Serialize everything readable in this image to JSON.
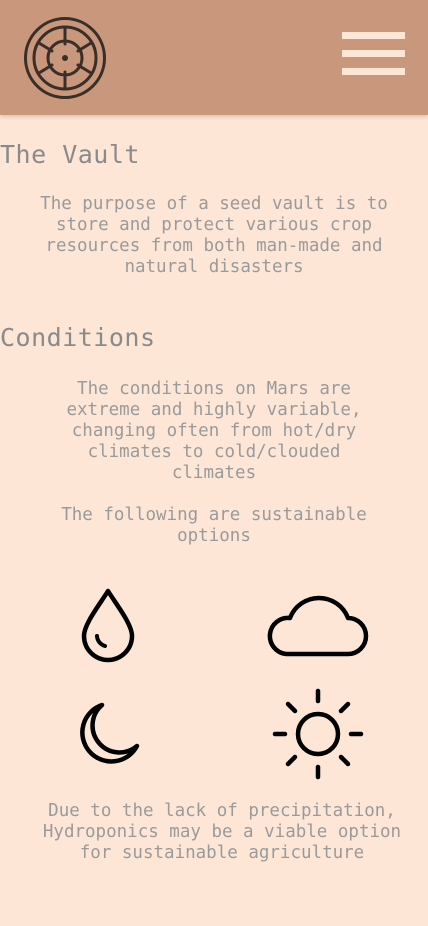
{
  "header": {
    "logo_icon": "vault-wheel-icon",
    "menu_icon": "hamburger-menu-icon",
    "background": "#c9977b"
  },
  "vault": {
    "title": "The Vault",
    "description": "The purpose of a seed vault is to store and protect various crop resources from both man-made and natural disasters"
  },
  "conditions": {
    "title": "Conditions",
    "description": "The conditions on Mars are extreme and highly variable, changing often from hot/dry climates to cold/clouded climates",
    "options_intro": "The following are sustainable options"
  },
  "icons": [
    "water-drop-icon",
    "cloud-icon",
    "moon-icon",
    "sun-icon"
  ],
  "footer_note": "Due to the lack of precipitation, Hydroponics may be a viable option for sustainable agriculture",
  "colors": {
    "page_background": "#fde6d6",
    "text": "#8a8a8a"
  }
}
